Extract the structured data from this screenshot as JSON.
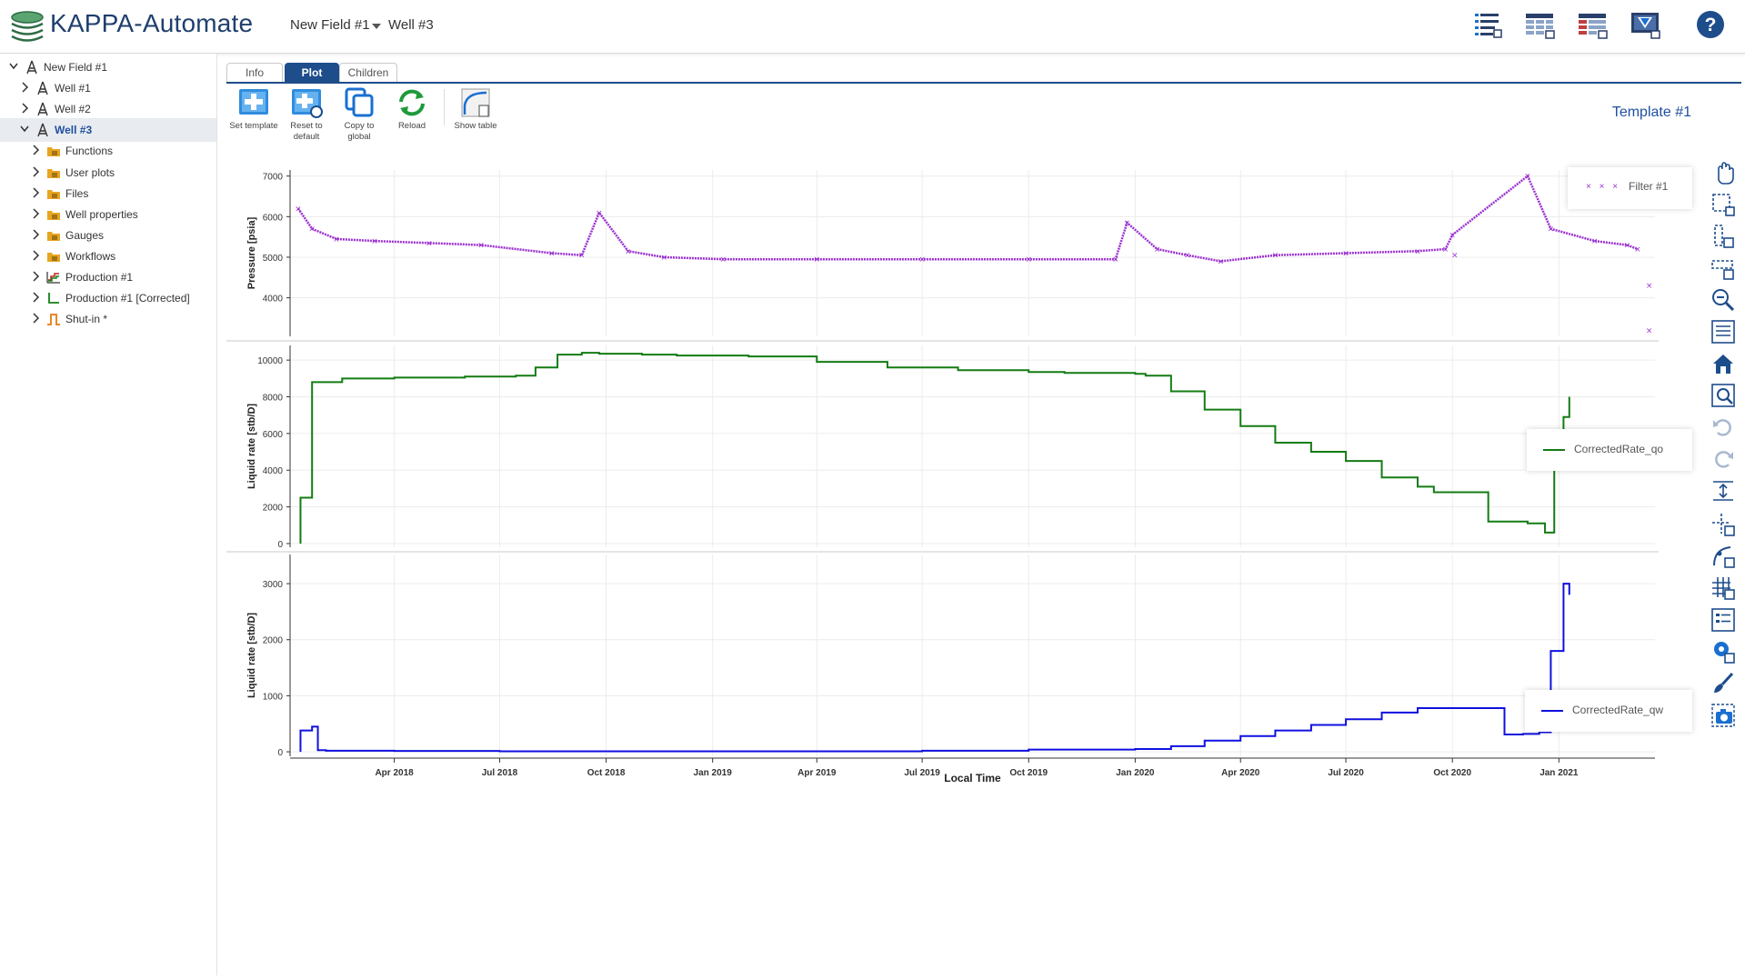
{
  "app": {
    "title": "KAPPA-Automate"
  },
  "breadcrumb": {
    "field": "New Field #1",
    "well": "Well #3"
  },
  "header_icons": [
    "list-view-icon",
    "grid-view-icon",
    "table-view-icon",
    "dashboard-icon",
    "help-icon"
  ],
  "tree": {
    "items": [
      {
        "label": "New Field #1",
        "icon": "rig-icon",
        "level": 0,
        "expanded": true
      },
      {
        "label": "Well #1",
        "icon": "rig-icon",
        "level": 1
      },
      {
        "label": "Well #2",
        "icon": "rig-icon",
        "level": 1
      },
      {
        "label": "Well #3",
        "icon": "rig-icon",
        "level": 1,
        "expanded": true,
        "selected": true
      },
      {
        "label": "Functions",
        "icon": "folder-functions-icon",
        "level": 2
      },
      {
        "label": "User plots",
        "icon": "folder-plots-icon",
        "level": 2
      },
      {
        "label": "Files",
        "icon": "folder-files-icon",
        "level": 2
      },
      {
        "label": "Well properties",
        "icon": "folder-properties-icon",
        "level": 2
      },
      {
        "label": "Gauges",
        "icon": "folder-gauges-icon",
        "level": 2
      },
      {
        "label": "Workflows",
        "icon": "folder-workflows-icon",
        "level": 2
      },
      {
        "label": "Production #1",
        "icon": "production-icon",
        "level": 2
      },
      {
        "label": "Production #1 [Corrected]",
        "icon": "production-corrected-icon",
        "level": 2
      },
      {
        "label": "Shut-in *",
        "icon": "shut-in-icon",
        "level": 2
      }
    ]
  },
  "tabs": [
    {
      "label": "Info",
      "active": false
    },
    {
      "label": "Plot",
      "active": true
    },
    {
      "label": "Children",
      "active": false
    }
  ],
  "toolbar": {
    "set_template": "Set template",
    "reset_to_default": "Reset to default",
    "copy_to_global": "Copy to global",
    "reload": "Reload",
    "show_table": "Show table"
  },
  "template_title": "Template #1",
  "colors": {
    "accent": "#1e4d8c",
    "pressure": "#9b30d0",
    "oil": "#137c13",
    "water": "#1010e0"
  },
  "chart_data": [
    {
      "type": "scatter",
      "ylabel": "Pressure [psia]",
      "ylim": [
        3050,
        7150
      ],
      "yticks": [
        4000,
        5000,
        6000,
        7000
      ],
      "x_ticks": [
        "Apr 2018",
        "Jul 2018",
        "Oct 2018",
        "Jan 2019",
        "Apr 2019",
        "Jul 2019",
        "Oct 2019",
        "Jan 2020",
        "Apr 2020",
        "Jul 2020",
        "Oct 2020",
        "Jan 2021"
      ],
      "xlabel": "",
      "series": [
        {
          "name": "Filter #1",
          "x": [
            "2018-01-08",
            "2018-01-20",
            "2018-02-10",
            "2018-03-15",
            "2018-05-01",
            "2018-06-15",
            "2018-08-15",
            "2018-09-10",
            "2018-09-25",
            "2018-10-20",
            "2018-11-20",
            "2019-01-10",
            "2019-04-01",
            "2019-07-01",
            "2019-10-01",
            "2019-12-15",
            "2019-12-25",
            "2020-01-20",
            "2020-02-15",
            "2020-03-15",
            "2020-05-01",
            "2020-07-01",
            "2020-09-01",
            "2020-09-25",
            "2020-10-01",
            "2020-12-05",
            "2020-12-25",
            "2021-02-01",
            "2021-03-01",
            "2021-03-10"
          ],
          "y": [
            6200,
            5700,
            5450,
            5400,
            5350,
            5300,
            5100,
            5050,
            6100,
            5150,
            5000,
            4950,
            4950,
            4950,
            4950,
            4950,
            5850,
            5200,
            5050,
            4900,
            5050,
            5100,
            5150,
            5200,
            5550,
            7000,
            5700,
            5400,
            5300,
            5200
          ]
        }
      ],
      "outliers_x": [
        "2020-10-03",
        "2021-03-20",
        "2021-03-20"
      ],
      "outliers_y": [
        5050,
        4300,
        3200
      ],
      "legend": "top-right"
    },
    {
      "type": "line",
      "ylabel": "Liquid rate [stb/D]",
      "ylim": [
        -200,
        10800
      ],
      "yticks": [
        0,
        2000,
        4000,
        6000,
        8000,
        10000
      ],
      "series": [
        {
          "name": "CorrectedRate_qo",
          "x": [
            "2018-01-10",
            "2018-01-20",
            "2018-02-15",
            "2018-04-01",
            "2018-06-01",
            "2018-07-15",
            "2018-08-01",
            "2018-08-20",
            "2018-09-10",
            "2018-09-25",
            "2018-11-01",
            "2018-12-01",
            "2019-02-01",
            "2019-04-01",
            "2019-06-01",
            "2019-08-01",
            "2019-10-01",
            "2019-11-01",
            "2020-01-01",
            "2020-01-10",
            "2020-02-01",
            "2020-03-01",
            "2020-04-01",
            "2020-05-01",
            "2020-06-01",
            "2020-07-01",
            "2020-08-01",
            "2020-09-01",
            "2020-09-15",
            "2020-11-01",
            "2020-12-05",
            "2020-12-20",
            "2020-12-28",
            "2021-01-05",
            "2021-01-10"
          ],
          "y": [
            2500,
            8800,
            9000,
            9050,
            9100,
            9150,
            9600,
            10300,
            10400,
            10350,
            10300,
            10250,
            10200,
            9900,
            9600,
            9450,
            9350,
            9300,
            9250,
            9150,
            8300,
            7300,
            6400,
            5500,
            5000,
            4500,
            3600,
            3100,
            2800,
            1200,
            1100,
            600,
            4600,
            6900,
            8000
          ]
        }
      ],
      "legend": "top-right"
    },
    {
      "type": "line",
      "ylabel": "Liquid rate [stb/D]",
      "ylim": [
        -80,
        3520
      ],
      "yticks": [
        0,
        1000,
        2000,
        3000
      ],
      "xlabel": "Local Time",
      "series": [
        {
          "name": "CorrectedRate_qw",
          "x": [
            "2018-01-10",
            "2018-01-20",
            "2018-01-25",
            "2018-02-01",
            "2018-04-01",
            "2018-07-01",
            "2018-10-01",
            "2019-01-01",
            "2019-04-01",
            "2019-07-01",
            "2019-10-01",
            "2020-01-01",
            "2020-02-01",
            "2020-03-01",
            "2020-04-01",
            "2020-05-01",
            "2020-06-01",
            "2020-07-01",
            "2020-08-01",
            "2020-09-01",
            "2020-10-01",
            "2020-11-15",
            "2020-12-01",
            "2020-12-15",
            "2020-12-25",
            "2021-01-05",
            "2021-01-10"
          ],
          "y": [
            380,
            450,
            30,
            20,
            15,
            10,
            10,
            10,
            10,
            20,
            40,
            50,
            100,
            200,
            280,
            380,
            480,
            580,
            700,
            780,
            780,
            310,
            320,
            350,
            1800,
            3000,
            2800
          ]
        }
      ],
      "legend": "top-right"
    }
  ],
  "right_tools": [
    "pan-icon",
    "box-zoom-icon",
    "y-zoom-icon",
    "x-zoom-icon",
    "zoom-icon",
    "zoom-region-icon",
    "home-icon",
    "zoom-fit-icon",
    "undo-icon",
    "redo-icon",
    "align-axes-icon",
    "add-point-icon",
    "curve-edit-icon",
    "grid-icon",
    "legend-icon",
    "marker-icon",
    "brush-icon",
    "camera-icon"
  ]
}
